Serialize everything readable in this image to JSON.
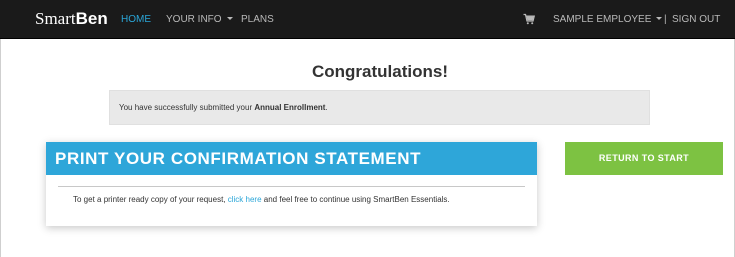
{
  "navbar": {
    "brand_light": "Smart",
    "brand_bold": "Ben",
    "home": "HOME",
    "your_info": "YOUR INFO",
    "plans": "PLANS",
    "employee": "SAMPLE EMPLOYEE",
    "separator": "|",
    "sign_out": "SIGN OUT",
    "active_color": "#2aa6d8"
  },
  "main": {
    "title": "Congratulations!",
    "notice_prefix": "You have successfully submitted your ",
    "notice_emphasis": "Annual Enrollment",
    "notice_suffix": "."
  },
  "confirmation": {
    "heading": "PRINT YOUR CONFIRMATION STATEMENT",
    "text_before": "To get a printer ready copy of your request, ",
    "link": "click here",
    "text_after": " and feel free to continue using SmartBen Essentials.",
    "header_color": "#2ea6d9"
  },
  "actions": {
    "return_label": "RETURN TO START",
    "return_color": "#7dc242"
  },
  "icons": {
    "cart": "shopping-cart-icon",
    "caret": "caret-down-icon"
  }
}
